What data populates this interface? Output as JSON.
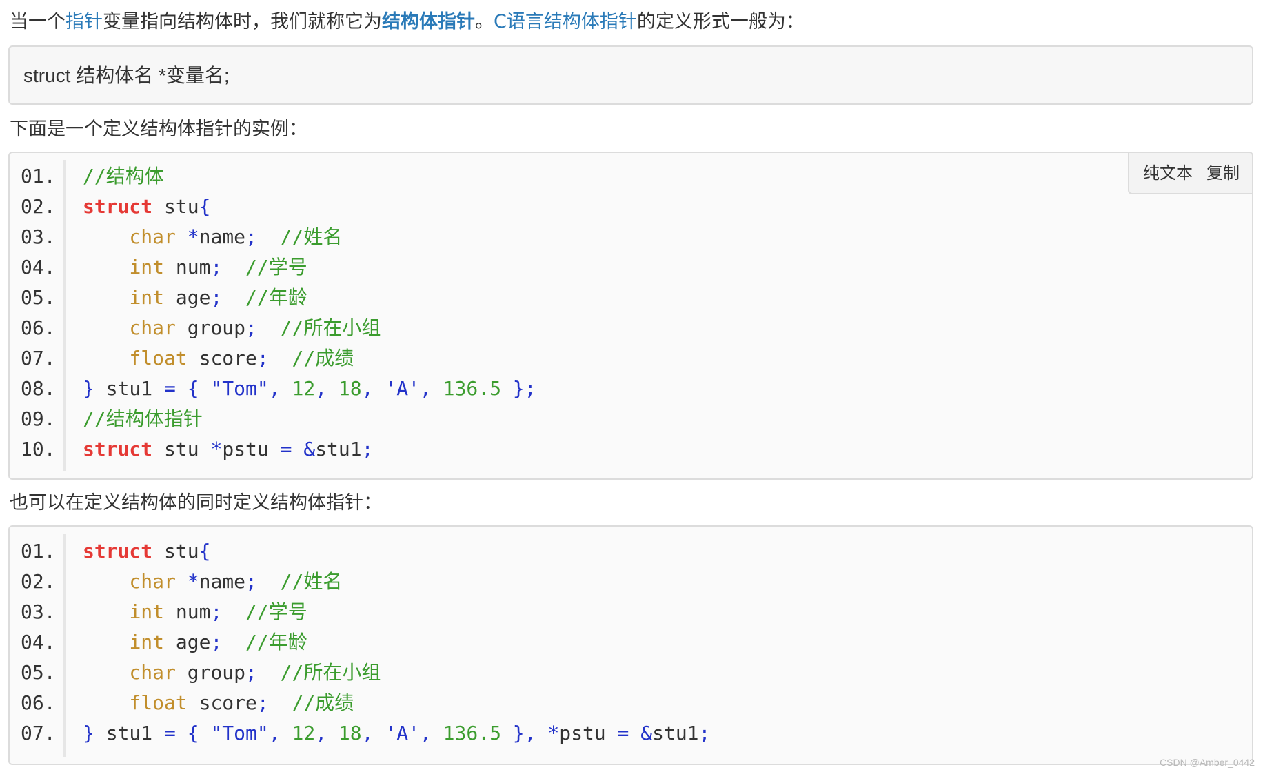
{
  "intro": {
    "part1": "当一个",
    "link_pointer": "指针",
    "part2": "变量指向结构体时，我们就称它为",
    "bold_struct_pointer": "结构体指针",
    "part3": "。",
    "link_c_struct_pointer": "C语言结构体指针",
    "part4": "的定义形式一般为："
  },
  "syntax": {
    "line": "struct 结构体名 *变量名;"
  },
  "para_example": "下面是一个定义结构体指针的实例：",
  "code1": {
    "toolbar": {
      "plain_text": "纯文本",
      "copy": "复制"
    },
    "line_numbers": [
      "01.",
      "02.",
      "03.",
      "04.",
      "05.",
      "06.",
      "07.",
      "08.",
      "09.",
      "10."
    ],
    "lines": [
      [
        {
          "t": "com",
          "v": "//结构体"
        }
      ],
      [
        {
          "t": "kw",
          "v": "struct"
        },
        {
          "t": "id",
          "v": " stu"
        },
        {
          "t": "op",
          "v": "{"
        }
      ],
      [
        {
          "t": "id",
          "v": "    "
        },
        {
          "t": "type",
          "v": "char"
        },
        {
          "t": "id",
          "v": " "
        },
        {
          "t": "op",
          "v": "*"
        },
        {
          "t": "id",
          "v": "name"
        },
        {
          "t": "op",
          "v": ";"
        },
        {
          "t": "id",
          "v": "  "
        },
        {
          "t": "com",
          "v": "//姓名"
        }
      ],
      [
        {
          "t": "id",
          "v": "    "
        },
        {
          "t": "type",
          "v": "int"
        },
        {
          "t": "id",
          "v": " num"
        },
        {
          "t": "op",
          "v": ";"
        },
        {
          "t": "id",
          "v": "  "
        },
        {
          "t": "com",
          "v": "//学号"
        }
      ],
      [
        {
          "t": "id",
          "v": "    "
        },
        {
          "t": "type",
          "v": "int"
        },
        {
          "t": "id",
          "v": " age"
        },
        {
          "t": "op",
          "v": ";"
        },
        {
          "t": "id",
          "v": "  "
        },
        {
          "t": "com",
          "v": "//年龄"
        }
      ],
      [
        {
          "t": "id",
          "v": "    "
        },
        {
          "t": "type",
          "v": "char"
        },
        {
          "t": "id",
          "v": " group"
        },
        {
          "t": "op",
          "v": ";"
        },
        {
          "t": "id",
          "v": "  "
        },
        {
          "t": "com",
          "v": "//所在小组"
        }
      ],
      [
        {
          "t": "id",
          "v": "    "
        },
        {
          "t": "type",
          "v": "float"
        },
        {
          "t": "id",
          "v": " score"
        },
        {
          "t": "op",
          "v": ";"
        },
        {
          "t": "id",
          "v": "  "
        },
        {
          "t": "com",
          "v": "//成绩"
        }
      ],
      [
        {
          "t": "op",
          "v": "}"
        },
        {
          "t": "id",
          "v": " stu1 "
        },
        {
          "t": "op",
          "v": "="
        },
        {
          "t": "id",
          "v": " "
        },
        {
          "t": "op",
          "v": "{"
        },
        {
          "t": "id",
          "v": " "
        },
        {
          "t": "str",
          "v": "\"Tom\""
        },
        {
          "t": "op",
          "v": ","
        },
        {
          "t": "id",
          "v": " "
        },
        {
          "t": "num",
          "v": "12"
        },
        {
          "t": "op",
          "v": ","
        },
        {
          "t": "id",
          "v": " "
        },
        {
          "t": "num",
          "v": "18"
        },
        {
          "t": "op",
          "v": ","
        },
        {
          "t": "id",
          "v": " "
        },
        {
          "t": "chr",
          "v": "'A'"
        },
        {
          "t": "op",
          "v": ","
        },
        {
          "t": "id",
          "v": " "
        },
        {
          "t": "num",
          "v": "136.5"
        },
        {
          "t": "id",
          "v": " "
        },
        {
          "t": "op",
          "v": "};"
        }
      ],
      [
        {
          "t": "com",
          "v": "//结构体指针"
        }
      ],
      [
        {
          "t": "kw",
          "v": "struct"
        },
        {
          "t": "id",
          "v": " stu "
        },
        {
          "t": "op",
          "v": "*"
        },
        {
          "t": "id",
          "v": "pstu "
        },
        {
          "t": "op",
          "v": "="
        },
        {
          "t": "id",
          "v": " "
        },
        {
          "t": "op",
          "v": "&"
        },
        {
          "t": "id",
          "v": "stu1"
        },
        {
          "t": "op",
          "v": ";"
        }
      ]
    ]
  },
  "para_also": "也可以在定义结构体的同时定义结构体指针：",
  "code2": {
    "line_numbers": [
      "01.",
      "02.",
      "03.",
      "04.",
      "05.",
      "06.",
      "07."
    ],
    "lines": [
      [
        {
          "t": "kw",
          "v": "struct"
        },
        {
          "t": "id",
          "v": " stu"
        },
        {
          "t": "op",
          "v": "{"
        }
      ],
      [
        {
          "t": "id",
          "v": "    "
        },
        {
          "t": "type",
          "v": "char"
        },
        {
          "t": "id",
          "v": " "
        },
        {
          "t": "op",
          "v": "*"
        },
        {
          "t": "id",
          "v": "name"
        },
        {
          "t": "op",
          "v": ";"
        },
        {
          "t": "id",
          "v": "  "
        },
        {
          "t": "com",
          "v": "//姓名"
        }
      ],
      [
        {
          "t": "id",
          "v": "    "
        },
        {
          "t": "type",
          "v": "int"
        },
        {
          "t": "id",
          "v": " num"
        },
        {
          "t": "op",
          "v": ";"
        },
        {
          "t": "id",
          "v": "  "
        },
        {
          "t": "com",
          "v": "//学号"
        }
      ],
      [
        {
          "t": "id",
          "v": "    "
        },
        {
          "t": "type",
          "v": "int"
        },
        {
          "t": "id",
          "v": " age"
        },
        {
          "t": "op",
          "v": ";"
        },
        {
          "t": "id",
          "v": "  "
        },
        {
          "t": "com",
          "v": "//年龄"
        }
      ],
      [
        {
          "t": "id",
          "v": "    "
        },
        {
          "t": "type",
          "v": "char"
        },
        {
          "t": "id",
          "v": " group"
        },
        {
          "t": "op",
          "v": ";"
        },
        {
          "t": "id",
          "v": "  "
        },
        {
          "t": "com",
          "v": "//所在小组"
        }
      ],
      [
        {
          "t": "id",
          "v": "    "
        },
        {
          "t": "type",
          "v": "float"
        },
        {
          "t": "id",
          "v": " score"
        },
        {
          "t": "op",
          "v": ";"
        },
        {
          "t": "id",
          "v": "  "
        },
        {
          "t": "com",
          "v": "//成绩"
        }
      ],
      [
        {
          "t": "op",
          "v": "}"
        },
        {
          "t": "id",
          "v": " stu1 "
        },
        {
          "t": "op",
          "v": "="
        },
        {
          "t": "id",
          "v": " "
        },
        {
          "t": "op",
          "v": "{"
        },
        {
          "t": "id",
          "v": " "
        },
        {
          "t": "str",
          "v": "\"Tom\""
        },
        {
          "t": "op",
          "v": ","
        },
        {
          "t": "id",
          "v": " "
        },
        {
          "t": "num",
          "v": "12"
        },
        {
          "t": "op",
          "v": ","
        },
        {
          "t": "id",
          "v": " "
        },
        {
          "t": "num",
          "v": "18"
        },
        {
          "t": "op",
          "v": ","
        },
        {
          "t": "id",
          "v": " "
        },
        {
          "t": "chr",
          "v": "'A'"
        },
        {
          "t": "op",
          "v": ","
        },
        {
          "t": "id",
          "v": " "
        },
        {
          "t": "num",
          "v": "136.5"
        },
        {
          "t": "id",
          "v": " "
        },
        {
          "t": "op",
          "v": "},"
        },
        {
          "t": "id",
          "v": " "
        },
        {
          "t": "op",
          "v": "*"
        },
        {
          "t": "id",
          "v": "pstu "
        },
        {
          "t": "op",
          "v": "="
        },
        {
          "t": "id",
          "v": " "
        },
        {
          "t": "op",
          "v": "&"
        },
        {
          "t": "id",
          "v": "stu1"
        },
        {
          "t": "op",
          "v": ";"
        }
      ]
    ]
  },
  "watermark": "CSDN @Amber_0442",
  "colors": {
    "link": "#2a7ab8",
    "keyword": "#e53935",
    "type": "#c18e2c",
    "operator": "#2232c9",
    "comment": "#3b9c2e"
  }
}
